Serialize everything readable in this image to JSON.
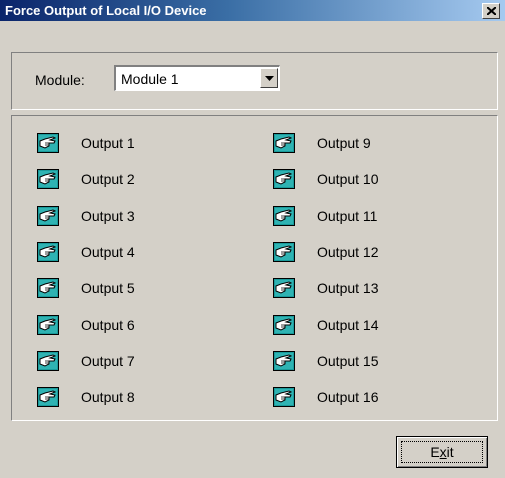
{
  "window": {
    "title": "Force Output of Local I/O Device",
    "close_glyph": "×"
  },
  "module": {
    "label": "Module:",
    "selected": "Module 1"
  },
  "outputs": {
    "left": [
      "Output 1",
      "Output 2",
      "Output 3",
      "Output 4",
      "Output 5",
      "Output 6",
      "Output 7",
      "Output 8"
    ],
    "right": [
      "Output 9",
      "Output 10",
      "Output 11",
      "Output 12",
      "Output 13",
      "Output 14",
      "Output 15",
      "Output 16"
    ],
    "icon": "pointing-hand-icon"
  },
  "footer": {
    "exit_prefix": "E",
    "exit_mnemonic": "x",
    "exit_suffix": "it"
  },
  "colors": {
    "title_start": "#0a246a",
    "title_end": "#a6caf0",
    "face": "#d4d0c8",
    "icon_teal": "#1a9a9a"
  }
}
